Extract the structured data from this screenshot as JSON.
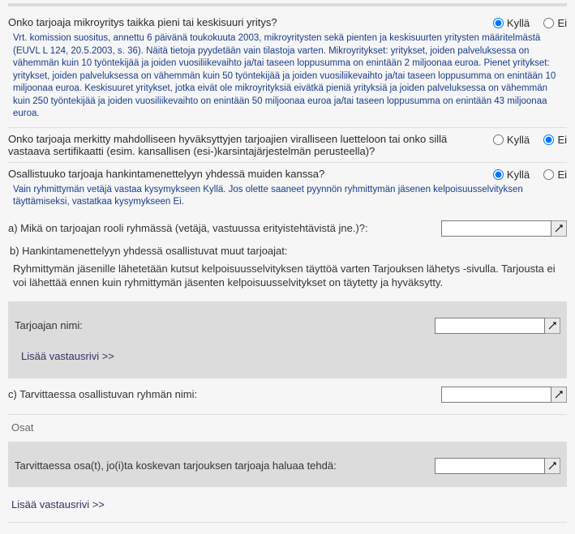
{
  "options": {
    "yes": "Kyllä",
    "no": "Ei"
  },
  "q1": {
    "text": "Onko tarjoaja mikroyritys taikka pieni tai keskisuuri yritys?",
    "note": "Vrt. komission suositus, annettu 6 päivänä toukokuuta 2003, mikroyritysten sekä pienten ja keskisuurten yritysten määritelmästä (EUVL L 124, 20.5.2003, s. 36). Näitä tietoja pyydetään vain tilastoja varten. Mikroyritykset: yritykset, joiden palveluksessa on vähemmän kuin 10 työntekijää ja joiden vuosiliikevaihto ja/tai taseen loppusumma on enintään 2 miljoonaa euroa. Pienet yritykset: yritykset, joiden palveluksessa on vähemmän kuin 50 työntekijää ja joiden vuosiliikevaihto ja/tai taseen loppusumma on enintään 10 miljoonaa euroa. Keskisuuret yritykset, jotka eivät ole mikroyrityksiä eivätkä pieniä yrityksiä ja joiden palveluksessa on vähemmän kuin 250 työntekijää ja joiden vuosiliikevaihto on enintään 50 miljoonaa euroa ja/tai taseen loppusumma on enintään 43 miljoonaa euroa."
  },
  "q2": {
    "text": "Onko tarjoaja merkitty mahdolliseen hyväksyttyjen tarjoajien viralliseen luetteloon tai onko sillä vastaava sertifikaatti (esim. kansallisen (esi-)karsintajärjestelmän perusteella)?"
  },
  "q3": {
    "text": "Osallistuuko tarjoaja hankintamenettelyyn yhdessä muiden kanssa?",
    "note": "Vain ryhmittymän vetäjä vastaa kysymykseen Kyllä. Jos olette saaneet pyynnön ryhmittymän jäsenen kelpoisuusselvityksen täyttämiseksi, vastatkaa kysymykseen Ei."
  },
  "fieldA": {
    "label": "a) Mikä on tarjoajan rooli ryhmässä (vetäjä, vastuussa erityistehtävistä jne.)?:"
  },
  "fieldB": {
    "label": "b) Hankintamenettelyyn yhdessä osallistuvat muut tarjoajat:",
    "info": "Ryhmittymän jäsenille lähetetään kutsut kelpoisuusselvityksen täyttöä varten Tarjouksen lähetys -sivulla. Tarjousta ei voi lähettää ennen kuin ryhmittymän jäsenten kelpoisuusselvitykset on täytetty ja hyväksytty.",
    "panel_label": "Tarjoajan nimi:",
    "add": "Lisää vastausrivi >>"
  },
  "fieldC": {
    "label": "c) Tarvittaessa osallistuvan ryhmän nimi:"
  },
  "sectionParts": {
    "title": "Osat",
    "panel_label": "Tarvittaessa osa(t), jo(i)ta koskevan tarjouksen tarjoaja haluaa tehdä:",
    "add": "Lisää vastausrivi >>"
  }
}
